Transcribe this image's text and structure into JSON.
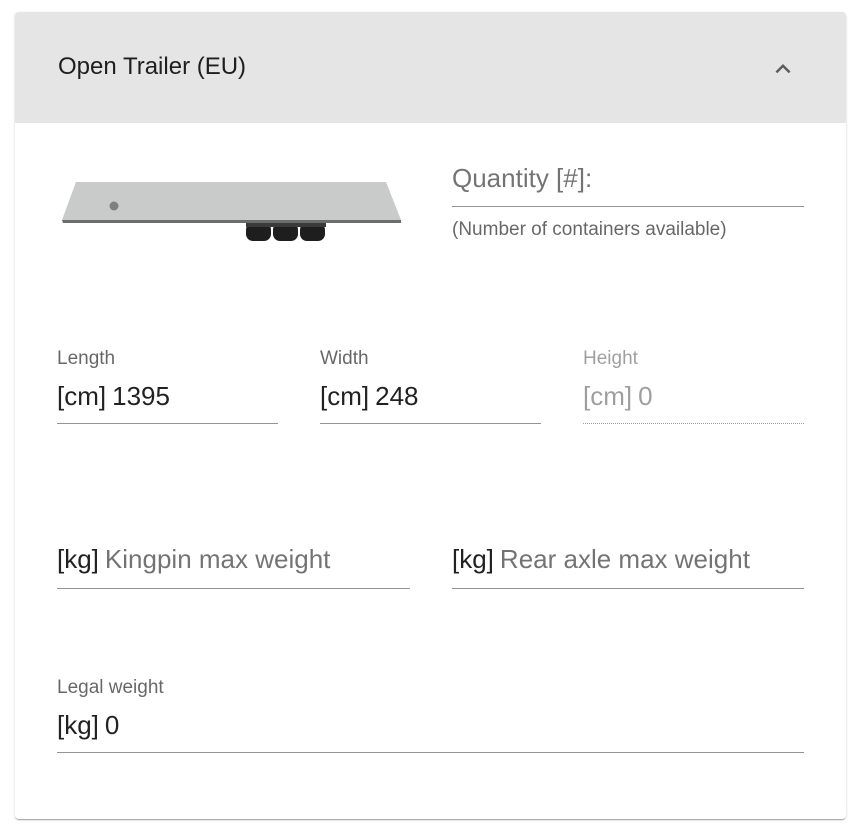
{
  "panel": {
    "title": "Open Trailer (EU)",
    "expand_icon": "chevron-up-icon"
  },
  "trailer_image": {
    "icon": "open-trailer-3d-image"
  },
  "quantity": {
    "placeholder": "Quantity [#]:",
    "value": "",
    "hint": "(Number of containers available)"
  },
  "dimensions": {
    "length": {
      "label": "Length",
      "prefix": "[cm]",
      "value": "1395"
    },
    "width": {
      "label": "Width",
      "prefix": "[cm]",
      "value": "248"
    },
    "height": {
      "label": "Height",
      "prefix": "[cm]",
      "value": "0",
      "disabled": true
    }
  },
  "weights": {
    "kingpin": {
      "prefix": "[kg]",
      "placeholder": "Kingpin max weight",
      "value": ""
    },
    "rear_axle": {
      "prefix": "[kg]",
      "placeholder": "Rear axle max weight",
      "value": ""
    },
    "legal": {
      "label": "Legal weight",
      "prefix": "[kg]",
      "value": "0"
    }
  },
  "colors": {
    "header_bg": "#e5e5e5",
    "trailer_deck": "#c8cbca",
    "wheels": "#222222"
  }
}
